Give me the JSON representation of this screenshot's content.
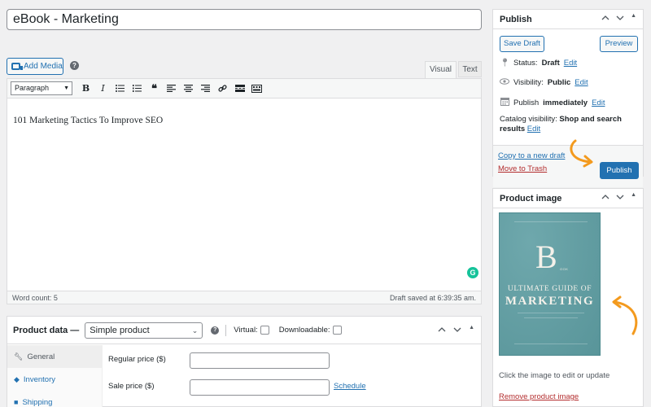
{
  "post": {
    "title": "eBook - Marketing",
    "content": "101 Marketing Tactics To Improve SEO"
  },
  "editor": {
    "add_media_label": "Add Media",
    "tabs": [
      "Visual",
      "Text"
    ],
    "format_value": "Paragraph",
    "word_count": "Word count: 5",
    "draft_saved": "Draft saved at 6:39:35 am."
  },
  "product_data": {
    "title": "Product data —",
    "type_value": "Simple product",
    "virtual_label": "Virtual:",
    "downloadable_label": "Downloadable:",
    "tabs": [
      "General",
      "Inventory",
      "Shipping"
    ],
    "regular_price_label": "Regular price ($)",
    "sale_price_label": "Sale price ($)",
    "schedule_label": "Schedule"
  },
  "publish": {
    "title": "Publish",
    "save_draft_label": "Save Draft",
    "preview_label": "Preview",
    "status_label": "Status:",
    "status_value": "Draft",
    "visibility_label": "Visibility:",
    "visibility_value": "Public",
    "publish_label": "Publish",
    "publish_value": "immediately",
    "catalog_label": "Catalog visibility:",
    "catalog_value": "Shop and search results",
    "edit_label": "Edit",
    "copy_draft_label": "Copy to a new draft",
    "trash_label": "Move to Trash",
    "publish_button_label": "Publish"
  },
  "product_image": {
    "title": "Product image",
    "cover_letter": "B",
    "cover_small": "OOK",
    "cover_line1": "ULTIMATE GUIDE OF",
    "cover_line2": "MARKETING",
    "hint": "Click the image to edit or update",
    "remove_label": "Remove product image"
  },
  "colors": {
    "accent": "#2271b1",
    "annotation_arrow": "#f39a1e",
    "trash": "#b32d2e"
  }
}
